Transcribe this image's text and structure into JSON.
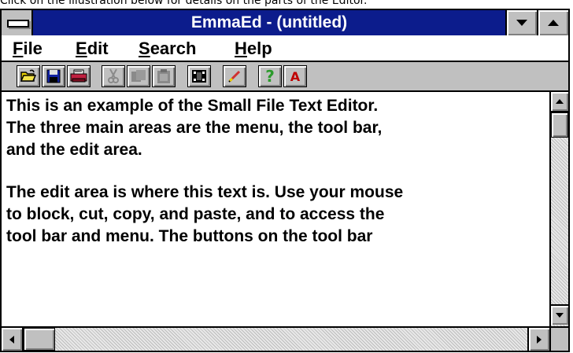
{
  "caption": "Click on the illustration below for details on the parts of the Editor.",
  "window": {
    "title": "EmmaEd - (untitled)"
  },
  "menu": {
    "items": [
      {
        "underlined": "F",
        "rest": "ile"
      },
      {
        "underlined": "E",
        "rest": "dit"
      },
      {
        "underlined": "S",
        "rest": "earch"
      },
      {
        "underlined": "H",
        "rest": "elp"
      }
    ]
  },
  "toolbar": {
    "buttons": [
      {
        "icon": "open-folder-icon",
        "enabled": true
      },
      {
        "icon": "save-disk-icon",
        "enabled": true
      },
      {
        "icon": "print-icon",
        "enabled": true
      },
      {
        "icon": "cut-scissors-icon",
        "enabled": false
      },
      {
        "icon": "copy-icon",
        "enabled": false
      },
      {
        "icon": "paste-clipboard-icon",
        "enabled": false
      },
      {
        "icon": "film-icon",
        "enabled": true
      },
      {
        "icon": "pencil-icon",
        "enabled": true
      },
      {
        "icon": "help-question-icon",
        "enabled": true
      },
      {
        "icon": "font-a-icon",
        "enabled": true
      }
    ],
    "help_glyph": "?",
    "font_glyph": "A"
  },
  "editor": {
    "paragraph1": [
      "This is an example of the Small File Text Editor.",
      "The three main areas are the menu, the tool bar,",
      "and the edit area."
    ],
    "paragraph2": [
      "The edit area is where this text is.  Use your mouse",
      "to block, cut, copy, and paste, and to access the",
      "tool bar and menu.  The buttons on the tool bar"
    ]
  },
  "colors": {
    "titlebar": "#0c1c8c",
    "chrome": "#c0c0c0",
    "open_icon": "#e8d000",
    "save_icon": "#1020a0",
    "print_icon": "#c02040",
    "help_icon": "#2a9a2a",
    "font_icon": "#c00000",
    "pencil_icon": "#d03030"
  }
}
